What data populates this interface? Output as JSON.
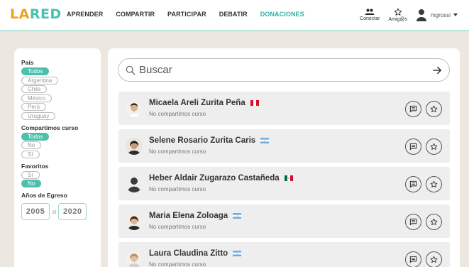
{
  "header": {
    "logo": {
      "part1": "LA",
      "part2": "RED"
    },
    "nav": [
      {
        "label": "APRENDER",
        "active": false
      },
      {
        "label": "COMPARTIR",
        "active": false
      },
      {
        "label": "PARTICIPAR",
        "active": false
      },
      {
        "label": "DEBATIR",
        "active": false
      },
      {
        "label": "DONACIONES",
        "active": true
      }
    ],
    "conectar_label": "Conectar",
    "amigos_label": "Amig@s",
    "user_name": "mgrossi"
  },
  "sidebar": {
    "pais": {
      "label": "País",
      "options": [
        "Todos",
        "Argentina",
        "Chile",
        "México",
        "Perú",
        "Uruguay"
      ],
      "selected": "Todos"
    },
    "compartimos": {
      "label": "Compartimos curso",
      "options": [
        "Todos",
        "No",
        "Sí"
      ],
      "selected": "Todos"
    },
    "favoritos": {
      "label": "Favoritos",
      "options": [
        "Sí",
        "No"
      ],
      "selected": "No"
    },
    "egreso": {
      "label": "Años de Egreso",
      "from": "2005",
      "sep": "al",
      "to": "2020"
    }
  },
  "search": {
    "placeholder": "Buscar",
    "value": ""
  },
  "people": [
    {
      "name": "Micaela Areli Zurita Peña",
      "status": "No compartimos curso",
      "flag": "peru"
    },
    {
      "name": "Selene Rosario Zurita Caris",
      "status": "No compartimos curso",
      "flag": "argentina"
    },
    {
      "name": "Heber Aldair Zugarazo Castañeda",
      "status": "No compartimos curso",
      "flag": "mexico"
    },
    {
      "name": "Maria Elena Zoloaga",
      "status": "No compartimos curso",
      "flag": "argentina"
    },
    {
      "name": "Laura Claudina Zitto",
      "status": "No compartimos curso",
      "flag": "argentina"
    }
  ],
  "colors": {
    "accent": "#4cc0ab",
    "logo_orange": "#f0a21b",
    "logo_teal": "#49c0b0",
    "background": "#ece8e0"
  }
}
